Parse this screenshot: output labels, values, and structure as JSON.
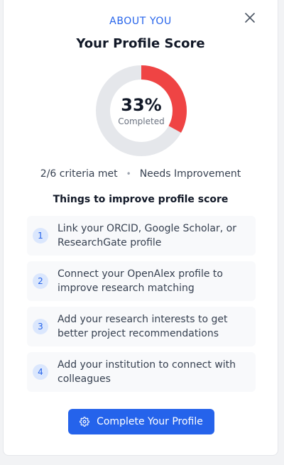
{
  "header": {
    "eyebrow": "ABOUT YOU",
    "title": "Your Profile Score",
    "close_icon": "close-icon"
  },
  "score": {
    "percent_label": "33%",
    "percent_value": 33,
    "status_label": "Completed",
    "criteria_met": "2/6 criteria met",
    "separator": "•",
    "rating": "Needs Improvement",
    "fill_color": "#ef4444",
    "track_color": "#e5e7eb"
  },
  "improvements": {
    "title": "Things to improve profile score",
    "items": [
      {
        "number": "1",
        "text": "Link your ORCID, Google Scholar, or ResearchGate profile"
      },
      {
        "number": "2",
        "text": "Connect your OpenAlex profile to improve research matching"
      },
      {
        "number": "3",
        "text": "Add your research interests to get better project recommendations"
      },
      {
        "number": "4",
        "text": "Add your institution to connect with colleagues"
      }
    ]
  },
  "cta": {
    "label": "Complete Your Profile",
    "icon": "gear-icon",
    "color": "#2563eb"
  }
}
